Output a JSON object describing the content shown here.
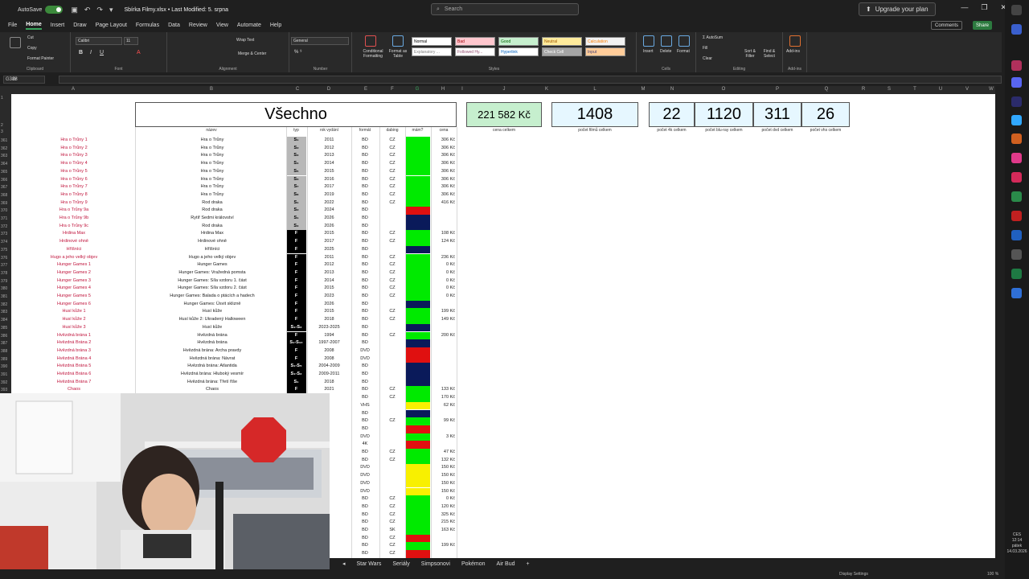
{
  "titlebar": {
    "autosave": "AutoSave",
    "doc_title": "Sbírka Filmy.xlsx • Last Modified: 5. srpna",
    "search_placeholder": "Search",
    "upgrade": "Upgrade your plan"
  },
  "menu_tabs": [
    "File",
    "Home",
    "Insert",
    "Draw",
    "Page Layout",
    "Formulas",
    "Data",
    "Review",
    "View",
    "Automate",
    "Help"
  ],
  "buttons": {
    "comments": "Comments",
    "share": "Share"
  },
  "ribbon": {
    "clipboard": {
      "cut": "Cut",
      "copy": "Copy",
      "format_painter": "Format Painter",
      "label": "Clipboard"
    },
    "font": {
      "name": "Calibri",
      "size": "11",
      "label": "Font"
    },
    "alignment": {
      "wrap": "Wrap Text",
      "merge": "Merge & Center",
      "label": "Alignment"
    },
    "number": {
      "format": "General",
      "label": "Number"
    },
    "styles": {
      "conditional": "Conditional Formatting",
      "format_table": "Format as Table",
      "boxes": [
        "Normal",
        "Bad",
        "Good",
        "Neutral",
        "Calculation",
        "Explanatory ...",
        "Followed Hy...",
        "Hyperlink",
        "Check Cell",
        "Input"
      ],
      "label": "Styles"
    },
    "cells": {
      "insert": "Insert",
      "delete": "Delete",
      "format": "Format",
      "label": "Cells"
    },
    "editing": {
      "autosum": "AutoSum",
      "fill": "Fill",
      "clear": "Clear",
      "sort": "Sort & Filter",
      "find": "Find & Select",
      "label": "Editing"
    },
    "addins": {
      "btn": "Add-ins",
      "label": "Add-ins"
    }
  },
  "formula_bar": {
    "name_box": "G388",
    "fx": "fx"
  },
  "columns": [
    "A",
    "B",
    "C",
    "D",
    "E",
    "F",
    "G",
    "H",
    "I",
    "J",
    "K",
    "L",
    "M",
    "N",
    "O",
    "P",
    "Q",
    "R",
    "S",
    "T",
    "U",
    "V",
    "W"
  ],
  "sheet_title": "Všechno",
  "headers": {
    "nazev": "název",
    "typ": "typ",
    "rok": "rok vydání",
    "format": "formát",
    "dabing": "dabing",
    "mam": "mám?",
    "cena": "cena"
  },
  "stats": [
    {
      "value": "221 582 Kč",
      "label": "cena celkem"
    },
    {
      "value": "1408",
      "label": "počet filmů celkem"
    },
    {
      "value": "22",
      "label": "počet 4k celkem"
    },
    {
      "value": "1120",
      "label": "počet blu-ray celkem"
    },
    {
      "value": "311",
      "label": "počet dvd celkem"
    },
    {
      "value": "26",
      "label": "počet vhs celkem"
    }
  ],
  "row_numbers_top": [
    "1",
    "2",
    "3"
  ],
  "rows": [
    {
      "n": "361",
      "a": "Hra o Trůny 1",
      "b": "Hra o Trůny",
      "c": "S₁",
      "ct": "gray",
      "d": "2011",
      "e": "BD",
      "f": "CZ",
      "g": "green",
      "h": "306 Kč"
    },
    {
      "n": "362",
      "a": "Hra o Trůny 2",
      "b": "Hra o Trůny",
      "c": "S₂",
      "ct": "gray",
      "d": "2012",
      "e": "BD",
      "f": "CZ",
      "g": "green",
      "h": "306 Kč"
    },
    {
      "n": "363",
      "a": "Hra o Trůny 3",
      "b": "Hra o Trůny",
      "c": "S₃",
      "ct": "gray",
      "d": "2013",
      "e": "BD",
      "f": "CZ",
      "g": "green",
      "h": "306 Kč"
    },
    {
      "n": "364",
      "a": "Hra o Trůny 4",
      "b": "Hra o Trůny",
      "c": "S₄",
      "ct": "gray",
      "d": "2014",
      "e": "BD",
      "f": "CZ",
      "g": "green",
      "h": "306 Kč"
    },
    {
      "n": "365",
      "a": "Hra o Trůny 5",
      "b": "Hra o Trůny",
      "c": "S₅",
      "ct": "gray",
      "d": "2015",
      "e": "BD",
      "f": "CZ",
      "g": "green",
      "h": "306 Kč"
    },
    {
      "n": "366",
      "a": "Hra o Trůny 6",
      "b": "Hra o Trůny",
      "c": "S₆",
      "ct": "gray",
      "d": "2016",
      "e": "BD",
      "f": "CZ",
      "g": "green",
      "h": "306 Kč"
    },
    {
      "n": "367",
      "a": "Hra o Trůny 7",
      "b": "Hra o Trůny",
      "c": "S₇",
      "ct": "gray",
      "d": "2017",
      "e": "BD",
      "f": "CZ",
      "g": "green",
      "h": "306 Kč"
    },
    {
      "n": "368",
      "a": "Hra o Trůny 8",
      "b": "Hra o Trůny",
      "c": "S₈",
      "ct": "gray",
      "d": "2019",
      "e": "BD",
      "f": "CZ",
      "g": "green",
      "h": "306 Kč"
    },
    {
      "n": "369",
      "a": "Hra o Trůny 9",
      "b": "Rod draka",
      "c": "S₁",
      "ct": "gray",
      "d": "2022",
      "e": "BD",
      "f": "CZ",
      "g": "green",
      "h": "416 Kč"
    },
    {
      "n": "370",
      "a": "Hra o Trůny 9a",
      "b": "Rod draka",
      "c": "S₂",
      "ct": "gray",
      "d": "2024",
      "e": "BD",
      "f": "",
      "g": "red",
      "h": ""
    },
    {
      "n": "371",
      "a": "Hra o Trůny 9b",
      "b": "Rytíř Sedmi království",
      "c": "S₁",
      "ct": "gray",
      "d": "2026",
      "e": "BD",
      "f": "",
      "g": "navy",
      "h": ""
    },
    {
      "n": "372",
      "a": "Hra o Trůny 9c",
      "b": "Rod draka",
      "c": "S₃",
      "ct": "gray",
      "d": "2026",
      "e": "BD",
      "f": "",
      "g": "navy",
      "h": ""
    },
    {
      "n": "373",
      "a": "Hrdina Max",
      "b": "Hrdina Max",
      "c": "F",
      "ct": "dark",
      "d": "2015",
      "e": "BD",
      "f": "CZ",
      "g": "green",
      "h": "108 Kč"
    },
    {
      "n": "374",
      "a": "Hrdinové ohně",
      "b": "Hrdinové ohně",
      "c": "F",
      "ct": "dark",
      "d": "2017",
      "e": "BD",
      "f": "CZ",
      "g": "green",
      "h": "124 Kč"
    },
    {
      "n": "375",
      "a": "Hříšníci",
      "b": "Hříšníci",
      "c": "F",
      "ct": "dark",
      "d": "2025",
      "e": "BD",
      "f": "",
      "g": "navy",
      "h": ""
    },
    {
      "n": "376",
      "a": "Hugo a jeho velký objev",
      "b": "Hugo a jeho velký objev",
      "c": "F",
      "ct": "dark",
      "d": "2011",
      "e": "BD",
      "f": "CZ",
      "g": "green",
      "h": "236 Kč"
    },
    {
      "n": "377",
      "a": "Hunger Games 1",
      "b": "Hunger Games",
      "c": "F",
      "ct": "dark",
      "d": "2012",
      "e": "BD",
      "f": "CZ",
      "g": "green",
      "h": "0 Kč"
    },
    {
      "n": "378",
      "a": "Hunger Games 2",
      "b": "Hunger Games: Vražedná pomsta",
      "c": "F",
      "ct": "dark",
      "d": "2013",
      "e": "BD",
      "f": "CZ",
      "g": "green",
      "h": "0 Kč"
    },
    {
      "n": "379",
      "a": "Hunger Games 3",
      "b": "Hunger Games: Síla vzdoru 1. část",
      "c": "F",
      "ct": "dark",
      "d": "2014",
      "e": "BD",
      "f": "CZ",
      "g": "green",
      "h": "0 Kč"
    },
    {
      "n": "380",
      "a": "Hunger Games 4",
      "b": "Hunger Games: Síla vzdoru 2. část",
      "c": "F",
      "ct": "dark",
      "d": "2015",
      "e": "BD",
      "f": "CZ",
      "g": "green",
      "h": "0 Kč"
    },
    {
      "n": "381",
      "a": "Hunger Games 5",
      "b": "Hunger Games: Balada o ptácích a hadech",
      "c": "F",
      "ct": "dark",
      "d": "2023",
      "e": "BD",
      "f": "CZ",
      "g": "green",
      "h": "0 Kč"
    },
    {
      "n": "382",
      "a": "Hunger Games 6",
      "b": "Hunger Games: Úsvit sklizně",
      "c": "F",
      "ct": "dark",
      "d": "2026",
      "e": "BD",
      "f": "",
      "g": "navy",
      "h": ""
    },
    {
      "n": "383",
      "a": "Husí kůže 1",
      "b": "Husí kůže",
      "c": "F",
      "ct": "dark",
      "d": "2015",
      "e": "BD",
      "f": "CZ",
      "g": "green",
      "h": "199 Kč"
    },
    {
      "n": "384",
      "a": "Husí kůže 2",
      "b": "Husí kůže 2: Ukradený Halloween",
      "c": "F",
      "ct": "dark",
      "d": "2018",
      "e": "BD",
      "f": "CZ",
      "g": "green",
      "h": "149 Kč"
    },
    {
      "n": "385",
      "a": "Husí kůže 3",
      "b": "Husí kůže",
      "c": "S₁-S₂",
      "ct": "dark",
      "d": "2023-2025",
      "e": "BD",
      "f": "",
      "g": "navy",
      "h": ""
    },
    {
      "n": "386",
      "a": "Hvězdná brána 1",
      "b": "Hvězdná brána",
      "c": "F",
      "ct": "dark",
      "d": "1994",
      "e": "BD",
      "f": "CZ",
      "g": "green",
      "h": "200 Kč"
    },
    {
      "n": "387",
      "a": "Hvězdná Brána 2",
      "b": "Hvězdná brána",
      "c": "S₁-S₁₀",
      "ct": "dark",
      "d": "1997-2007",
      "e": "BD",
      "f": "",
      "g": "navy",
      "h": ""
    },
    {
      "n": "388",
      "a": "Hvězdná brána 3",
      "b": "Hvězdná brána: Archa pravdy",
      "c": "F",
      "ct": "dark",
      "d": "2008",
      "e": "DVD",
      "f": "",
      "g": "red",
      "h": ""
    },
    {
      "n": "389",
      "a": "Hvězdná Brána 4",
      "b": "Hvězdná brána: Návrat",
      "c": "F",
      "ct": "dark",
      "d": "2008",
      "e": "DVD",
      "f": "",
      "g": "red",
      "h": ""
    },
    {
      "n": "390",
      "a": "Hvězdná Brána 5",
      "b": "Hvězdná brána: Atlantida",
      "c": "S₁-S₅",
      "ct": "dark",
      "d": "2004-2009",
      "e": "BD",
      "f": "",
      "g": "navy",
      "h": ""
    },
    {
      "n": "391",
      "a": "Hvězdná Brána 6",
      "b": "Hvězdná brána: Hluboký vesmír",
      "c": "S₁-S₂",
      "ct": "dark",
      "d": "2009-2011",
      "e": "BD",
      "f": "",
      "g": "navy",
      "h": ""
    },
    {
      "n": "392",
      "a": "Hvězdná Brána 7",
      "b": "Hvězdná brána: Třetí říše",
      "c": "S₁",
      "ct": "dark",
      "d": "2018",
      "e": "BD",
      "f": "",
      "g": "navy",
      "h": ""
    },
    {
      "n": "393",
      "a": "Chaos",
      "b": "Chaos",
      "c": "F",
      "ct": "dark",
      "d": "2021",
      "e": "BD",
      "f": "CZ",
      "g": "green",
      "h": "133 Kč"
    }
  ],
  "rows_partial": [
    {
      "d": "15",
      "e": "BD",
      "f": "CZ",
      "g": "green",
      "h": "170 Kč"
    },
    {
      "d": "89",
      "e": "VHS",
      "f": "",
      "g": "yellow",
      "h": "62 Kč"
    },
    {
      "d": "23",
      "e": "BD",
      "f": "",
      "g": "navy",
      "h": ""
    },
    {
      "d": "19",
      "e": "BD",
      "f": "CZ",
      "g": "green",
      "h": "99 Kč"
    },
    {
      "d": "14",
      "e": "BD",
      "f": "",
      "g": "red",
      "h": ""
    },
    {
      "d": "10",
      "e": "DVD",
      "f": "",
      "g": "green",
      "h": "3 Kč"
    },
    {
      "d": "07",
      "e": "4K",
      "f": "",
      "g": "red",
      "h": ""
    },
    {
      "d": "16",
      "e": "BD",
      "f": "CZ",
      "g": "green",
      "h": "47 Kč"
    },
    {
      "d": "24",
      "e": "BD",
      "f": "CZ",
      "g": "green",
      "h": "132 Kč"
    },
    {
      "d": "81",
      "e": "DVD",
      "f": "",
      "g": "yellow",
      "h": "150 Kč"
    },
    {
      "d": "84",
      "e": "DVD",
      "f": "",
      "g": "yellow",
      "h": "150 Kč"
    },
    {
      "d": "89",
      "e": "DVD",
      "f": "",
      "g": "yellow",
      "h": "150 Kč"
    },
    {
      "d": "90",
      "e": "DVD",
      "f": "",
      "g": "yellow",
      "h": "150 Kč"
    },
    {
      "d": "23",
      "e": "BD",
      "f": "CZ",
      "g": "green",
      "h": "0 Kč"
    },
    {
      "d": "08",
      "e": "BD",
      "f": "CZ",
      "g": "green",
      "h": "120 Kč"
    },
    {
      "d": "14",
      "e": "BD",
      "f": "CZ",
      "g": "green",
      "h": "325 Kč"
    },
    {
      "d": "14",
      "e": "BD",
      "f": "CZ",
      "g": "green",
      "h": "215 Kč"
    },
    {
      "d": "23",
      "e": "BD",
      "f": "SK",
      "g": "green",
      "h": "163 Kč"
    },
    {
      "d": "07",
      "e": "BD",
      "f": "CZ",
      "g": "red",
      "h": ""
    },
    {
      "d": "07",
      "e": "BD",
      "f": "CZ",
      "g": "green",
      "h": "199 Kč"
    },
    {
      "d": "90",
      "e": "BD",
      "f": "CZ",
      "g": "red",
      "h": ""
    }
  ],
  "sheet_tabs": [
    "Star Wars",
    "Seriály",
    "Simpsonovi",
    "Pokémon",
    "Air Bud"
  ],
  "status": {
    "display_settings": "Display Settings",
    "zoom": "100 %"
  },
  "clock": {
    "time": "12:14",
    "day": "pátek",
    "date": "14.03.2026",
    "lang": "CES"
  },
  "colors": {
    "accent": "#3aa55d",
    "mam_green": "#00ea00",
    "mam_red": "#e01010",
    "mam_navy": "#0a1a5a",
    "mam_yellow": "#f8f000",
    "name_red": "#c0143c"
  }
}
